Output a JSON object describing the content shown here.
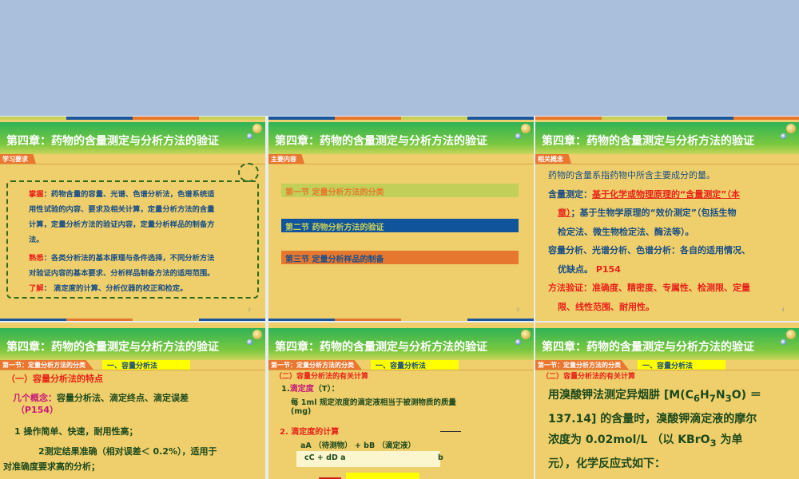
{
  "chapter_title": "第四章：药物的含量测定与分析方法的验证",
  "slides": [
    {
      "tab": "学习要求",
      "page": "2",
      "items": [
        {
          "label": "掌握",
          "sep": "：",
          "lines": [
            "药物含量的容量、光谱、色谱分析法，色谱系统适",
            "用性试验的内容、要求及相关计算，定量分析方法的含量",
            "计算，定量分析方法的验证内容，定量分析样品的制备方",
            "法。"
          ]
        },
        {
          "label": "熟悉",
          "sep": "：",
          "lines": [
            "各类分析法的基本原理与条件选择，不同分析方法",
            "对验证内容的基本要求、分析样品制备方法的适用范围。"
          ]
        },
        {
          "label": "了解",
          "sep": "：",
          "lines": [
            " 滴定度的计算、分析仪器的校正和检定。"
          ]
        }
      ]
    },
    {
      "tab": "主要内容",
      "page": "3",
      "sections": [
        {
          "text": "第一节   定量分析方法的分类",
          "bg": "#c2cf58",
          "color": "#e8782d"
        },
        {
          "text": "第二节   药物分析方法的验证",
          "bg": "#10549c",
          "color": "#c8d05a"
        },
        {
          "text": "第三节   定量分析样品的制备",
          "bg": "#e6772e",
          "color": "#1d4f86"
        }
      ]
    },
    {
      "tab": "相关概念",
      "page": "4",
      "intro": "药物的含量系指药物中所含主要成分的量。",
      "l1a": "含量测定：",
      "l1b": "基于化学或物理原理的“含量测定”（本",
      "l2a": "章）",
      "l2b": "；基于生物学原理的“效价测定”（包括生物",
      "l3": "检定法、微生物检定法、酶法等）。",
      "l4": "容量分析、光谱分析、色谱分析：各自的适用情况、",
      "l5a": "优缺点。 ",
      "l5b": "P154",
      "l6": "方法验证：准确度、精密度、专属性、检测限、定量",
      "l7": "限、线性范围、耐用性。"
    },
    {
      "tab": "第一节：定量分析方法的分类",
      "tab2": "一、容量分析法",
      "heading": "（一）容量分析法的特点",
      "concept_label": "几个概念：",
      "concept_text": "容量分析法、滴定终点、滴定误差",
      "concept_ref": "（P154）",
      "p1": "1      操作简单、快速，耐用性高；",
      "p2": "2测定结果准确（相对误差＜ 0.2%），适用于",
      "p3": "对准确度要求高的分析；"
    },
    {
      "tab": "第一节：定量分析方法的分类",
      "tab2": "一、容量分析法",
      "heading": "（二）容量分析法的有关计算",
      "s1num": "1.",
      "s1": "滴定度",
      "s1b": "（T）：",
      "d1": "每 1ml 规定浓度的滴定液相当于被测物质的质量",
      "d2": "(mg)",
      "s2": "2. 滴定度的计算",
      "eq1": "aA （待测物）      +       bB （滴定液）",
      "eq2a": "cC     +      dD a",
      "eq2b": "b"
    },
    {
      "tab": "第一节：定量分析方法的分类",
      "tab2": "一、容量分析法",
      "heading": "（二）容量分析法的有关计算",
      "body_html": "用溴酸钾法测定异烟肼 [M(C<sub>6</sub>H<sub>7</sub>N<sub>3</sub>O) ＝<br>137.14] 的含量时，溴酸钾滴定液的摩尔<br>浓度为 0.02mol/L （以 KBrO<sub>3</sub> 为单<br>元），化学反应式如下："
    }
  ],
  "colors": {
    "blue": "#1a4f86",
    "red": "#e8231b",
    "green": "#1d4a1d"
  }
}
